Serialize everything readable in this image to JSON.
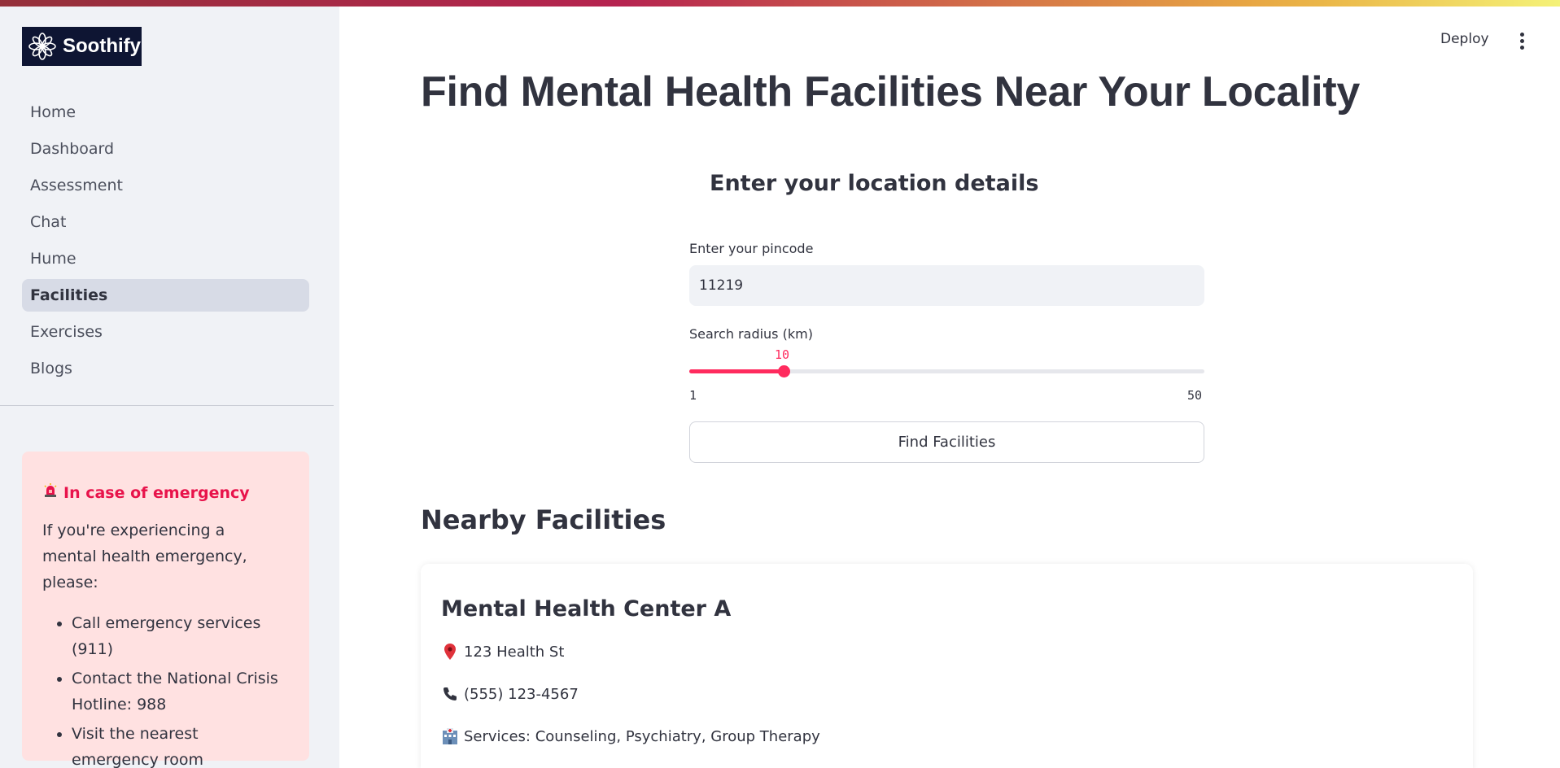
{
  "app": {
    "brand": "Soothify",
    "deploy_label": "Deploy"
  },
  "sidebar": {
    "items": [
      {
        "label": "Home",
        "active": false
      },
      {
        "label": "Dashboard",
        "active": false
      },
      {
        "label": "Assessment",
        "active": false
      },
      {
        "label": "Chat",
        "active": false
      },
      {
        "label": "Hume",
        "active": false
      },
      {
        "label": "Facilities",
        "active": true
      },
      {
        "label": "Exercises",
        "active": false
      },
      {
        "label": "Blogs",
        "active": false
      }
    ],
    "emergency": {
      "icon": "siren-icon",
      "title": "In case of emergency",
      "body": "If you're experiencing a mental health emergency, please:",
      "list": [
        "Call emergency services (911)",
        "Contact the National Crisis Hotline: 988",
        "Visit the nearest emergency room"
      ]
    }
  },
  "main": {
    "title": "Find Mental Health Facilities Near Your Locality",
    "subtitle": "Enter your location details",
    "pincode": {
      "label": "Enter your pincode",
      "value": "11219"
    },
    "radius": {
      "label": "Search radius (km)",
      "value": 10,
      "value_label": "10",
      "min": 1,
      "max": 50,
      "min_label": "1",
      "max_label": "50"
    },
    "find_button_label": "Find Facilities",
    "nearby_title": "Nearby Facilities",
    "facilities": [
      {
        "name": "Mental Health Center A",
        "address": "123 Health St",
        "phone": "(555) 123-4567",
        "services": "Services: Counseling, Psychiatry, Group Therapy"
      }
    ]
  },
  "colors": {
    "accent": "#ff2b5e",
    "sidebar_bg": "#f0f2f6",
    "emergency_bg": "#ffe1e1",
    "emergency_title": "#e8134b",
    "logo_bg": "#0e1533"
  }
}
